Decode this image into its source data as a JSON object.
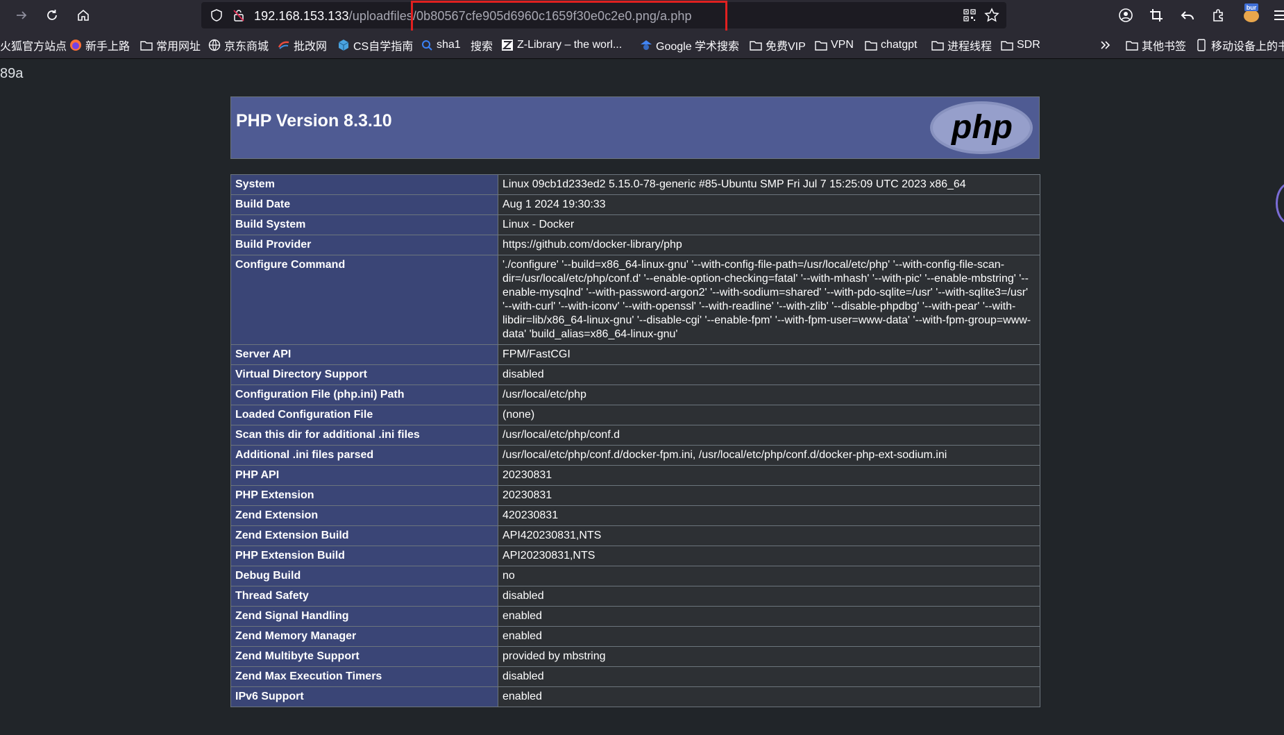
{
  "browser": {
    "url_host": "192.168.153.133",
    "url_path": "/uploadfiles/0b80567cfe905d6960c1659f30e0c2e0.png/a.php",
    "burp_badge": "bur"
  },
  "bookmarks": [
    {
      "label": "火狐官方站点",
      "icon": "firefox-icon"
    },
    {
      "label": "新手上路",
      "icon": "firefox-icon"
    },
    {
      "label": "常用网址",
      "icon": "folder-icon"
    },
    {
      "label": "京东商城",
      "icon": "globe-icon"
    },
    {
      "label": "批改网",
      "icon": "pigai-icon"
    },
    {
      "label": "CS自学指南",
      "icon": "cube-icon"
    },
    {
      "label": "sha1",
      "icon": "search-icon"
    },
    {
      "label": "搜索",
      "icon": ""
    },
    {
      "label": "Z-Library – the worl...",
      "icon": "zlib-icon"
    },
    {
      "label": "Google 学术搜索",
      "icon": "scholar-icon"
    },
    {
      "label": "免费VIP",
      "icon": "folder-icon"
    },
    {
      "label": "VPN",
      "icon": "folder-icon"
    },
    {
      "label": "chatgpt",
      "icon": "folder-icon"
    },
    {
      "label": "进程线程",
      "icon": "folder-icon"
    },
    {
      "label": "SDR",
      "icon": "folder-icon"
    }
  ],
  "bookmarks_right": [
    {
      "label": "其他书签",
      "icon": "folder-icon"
    },
    {
      "label": "移动设备上的书签",
      "icon": "mobile-icon"
    }
  ],
  "page": {
    "echo_text": "89a",
    "php_title": "PHP Version 8.3.10",
    "php_logo_text": "php"
  },
  "phpinfo_rows": [
    {
      "key": "System",
      "value": "Linux 09cb1d233ed2 5.15.0-78-generic #85-Ubuntu SMP Fri Jul 7 15:25:09 UTC 2023 x86_64"
    },
    {
      "key": "Build Date",
      "value": "Aug 1 2024 19:30:33"
    },
    {
      "key": "Build System",
      "value": "Linux - Docker"
    },
    {
      "key": "Build Provider",
      "value": "https://github.com/docker-library/php"
    },
    {
      "key": "Configure Command",
      "value": "'./configure' '--build=x86_64-linux-gnu' '--with-config-file-path=/usr/local/etc/php' '--with-config-file-scan-dir=/usr/local/etc/php/conf.d' '--enable-option-checking=fatal' '--with-mhash' '--with-pic' '--enable-mbstring' '--enable-mysqlnd' '--with-password-argon2' '--with-sodium=shared' '--with-pdo-sqlite=/usr' '--with-sqlite3=/usr' '--with-curl' '--with-iconv' '--with-openssl' '--with-readline' '--with-zlib' '--disable-phpdbg' '--with-pear' '--with-libdir=lib/x86_64-linux-gnu' '--disable-cgi' '--enable-fpm' '--with-fpm-user=www-data' '--with-fpm-group=www-data' 'build_alias=x86_64-linux-gnu'"
    },
    {
      "key": "Server API",
      "value": "FPM/FastCGI"
    },
    {
      "key": "Virtual Directory Support",
      "value": "disabled"
    },
    {
      "key": "Configuration File (php.ini) Path",
      "value": "/usr/local/etc/php"
    },
    {
      "key": "Loaded Configuration File",
      "value": "(none)"
    },
    {
      "key": "Scan this dir for additional .ini files",
      "value": "/usr/local/etc/php/conf.d"
    },
    {
      "key": "Additional .ini files parsed",
      "value": "/usr/local/etc/php/conf.d/docker-fpm.ini, /usr/local/etc/php/conf.d/docker-php-ext-sodium.ini"
    },
    {
      "key": "PHP API",
      "value": "20230831"
    },
    {
      "key": "PHP Extension",
      "value": "20230831"
    },
    {
      "key": "Zend Extension",
      "value": "420230831"
    },
    {
      "key": "Zend Extension Build",
      "value": "API420230831,NTS"
    },
    {
      "key": "PHP Extension Build",
      "value": "API20230831,NTS"
    },
    {
      "key": "Debug Build",
      "value": "no"
    },
    {
      "key": "Thread Safety",
      "value": "disabled"
    },
    {
      "key": "Zend Signal Handling",
      "value": "enabled"
    },
    {
      "key": "Zend Memory Manager",
      "value": "enabled"
    },
    {
      "key": "Zend Multibyte Support",
      "value": "provided by mbstring"
    },
    {
      "key": "Zend Max Execution Timers",
      "value": "disabled"
    },
    {
      "key": "IPv6 Support",
      "value": "enabled"
    }
  ],
  "colors": {
    "header_bg": "#4f5b93",
    "key_cell_bg": "#3a4576",
    "value_cell_bg": "#2d3034",
    "highlight_box": "#e02020"
  }
}
